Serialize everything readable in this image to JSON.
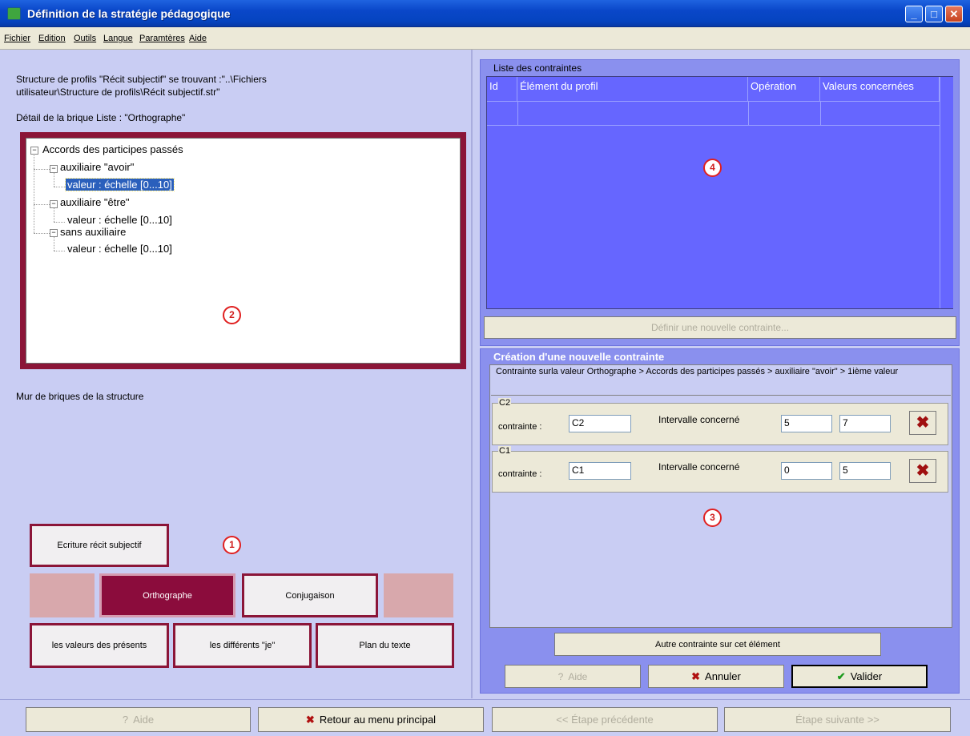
{
  "window": {
    "title": "Définition de la stratégie pédagogique",
    "minimize": "_",
    "maximize": "□",
    "close": "✕"
  },
  "menu": [
    "Fichier",
    "Edition",
    "Outils",
    "Langue",
    "Paramtères",
    "Aide"
  ],
  "left": {
    "structure_line1": "Structure de profils \"Récit subjectif\" se trouvant :\"..\\Fichiers",
    "structure_line2": "utilisateur\\Structure de profils\\Récit subjectif.str\"",
    "detail_label": "Détail de la brique Liste : \"Orthographe\"",
    "tree": {
      "root": "Accords des participes passés",
      "n1": "auxiliaire \"avoir\"",
      "n1_child": "valeur : échelle [0...10]",
      "n2": "auxiliaire \"être\"",
      "n2_child": "valeur : échelle [0...10]",
      "n3": "sans auxiliaire",
      "n3_child": "valeur : échelle [0...10]",
      "expander": "−"
    },
    "wall_label": "Mur de briques de la structure",
    "bricks": {
      "top": "Ecriture récit subjectif",
      "orthographe": "Orthographe",
      "conjugaison": "Conjugaison",
      "presents": "les valeurs des présents",
      "je": "les différents \"je\"",
      "plan": "Plan du texte"
    }
  },
  "markers": {
    "m1": "1",
    "m2": "2",
    "m3": "3",
    "m4": "4"
  },
  "constraints_list": {
    "title": "Liste des contraintes",
    "columns": [
      "Id",
      "Élément du profil",
      "Opération",
      "Valeurs concernées"
    ],
    "define_button": "Définir une nouvelle contrainte..."
  },
  "new_constraint": {
    "title": "Création d'une nouvelle contrainte",
    "path": "Contrainte surla valeur Orthographe > Accords des participes passés > auxiliaire \"avoir\" > 1ième valeur",
    "rows": [
      {
        "group": "C2",
        "label": "contrainte :",
        "name": "C2",
        "interval_label": "Intervalle concerné",
        "min": "5",
        "max": "7"
      },
      {
        "group": "C1",
        "label": "contrainte :",
        "name": "C1",
        "interval_label": "Intervalle concerné",
        "min": "0",
        "max": "5"
      }
    ],
    "delete_glyph": "✖",
    "other_button": "Autre contrainte sur cet élément",
    "help_button": "Aide",
    "cancel_button": "Annuler",
    "validate_button": "Valider"
  },
  "footer": {
    "help": "Aide",
    "back": "Retour au menu principal",
    "prev": "<< Étape précédente",
    "next": "Étape suivante  >>"
  }
}
